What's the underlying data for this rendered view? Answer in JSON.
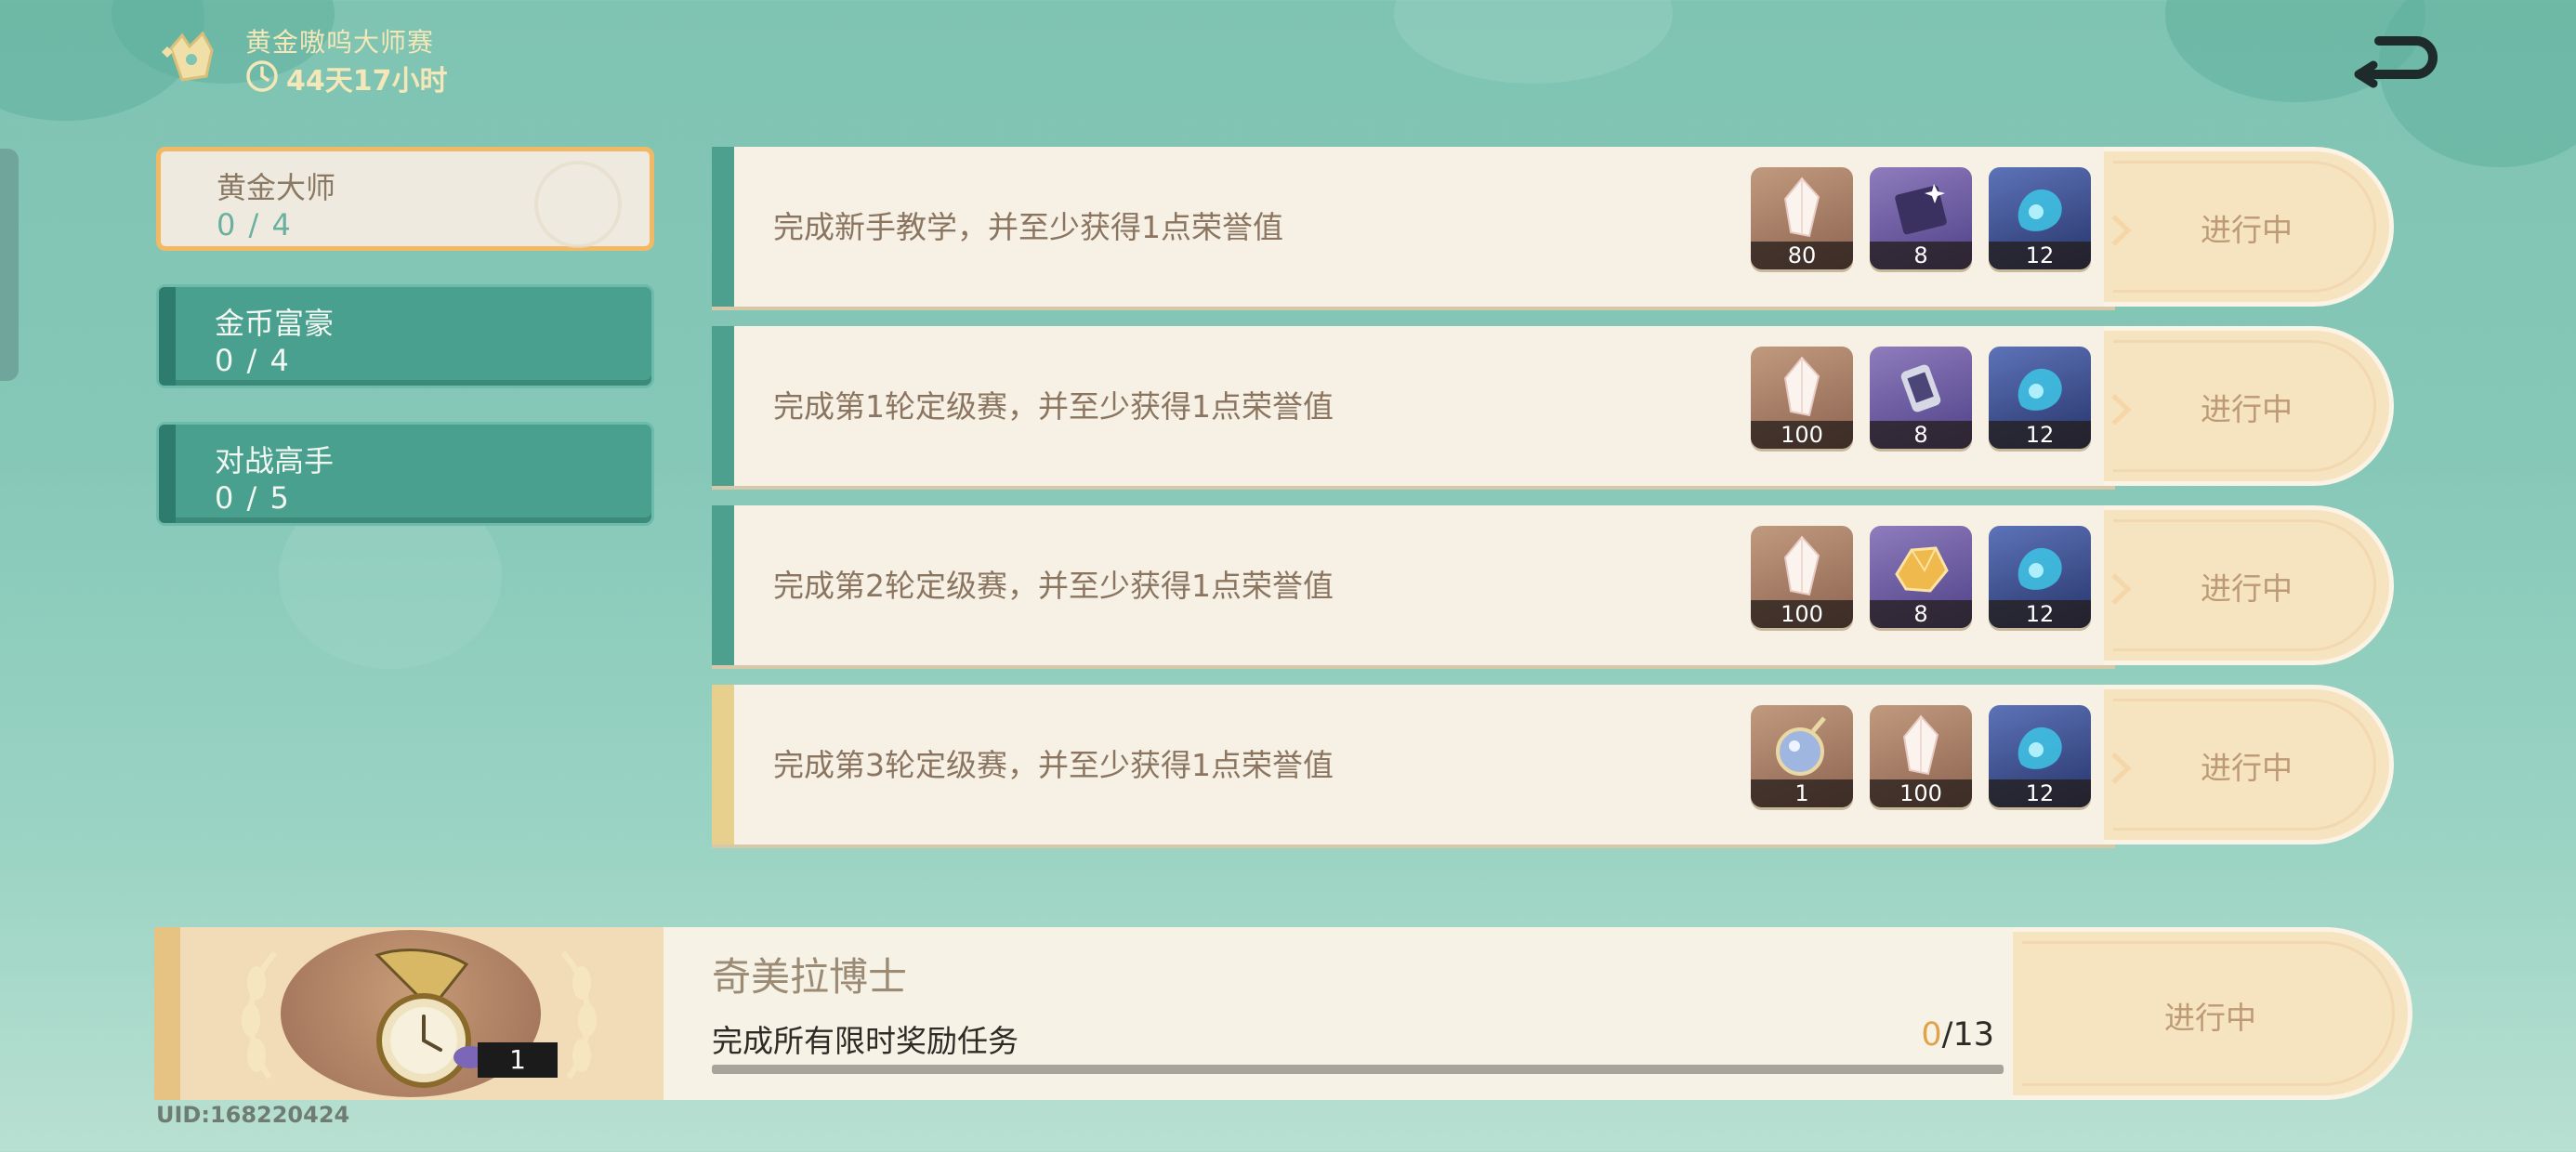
{
  "header": {
    "event_title": "黄金嗷呜大师赛",
    "time_left": "44天17小时"
  },
  "tabs": [
    {
      "name": "黄金大师",
      "count": "0 / 4",
      "active": true
    },
    {
      "name": "金币富豪",
      "count": "0 / 4",
      "active": false
    },
    {
      "name": "对战高手",
      "count": "0 / 5",
      "active": false
    }
  ],
  "quests": [
    {
      "text": "完成新手教学，并至少获得1点荣誉值",
      "status": "进行中",
      "rewards": [
        {
          "icon": "crystal-icon",
          "qty": "80"
        },
        {
          "icon": "book-icon",
          "qty": "8"
        },
        {
          "icon": "blue-spirit-icon",
          "qty": "12"
        }
      ]
    },
    {
      "text": "完成第1轮定级赛，并至少获得1点荣誉值",
      "status": "进行中",
      "rewards": [
        {
          "icon": "crystal-icon",
          "qty": "100"
        },
        {
          "icon": "lantern-icon",
          "qty": "8"
        },
        {
          "icon": "blue-spirit-icon",
          "qty": "12"
        }
      ]
    },
    {
      "text": "完成第2轮定级赛，并至少获得1点荣誉值",
      "status": "进行中",
      "rewards": [
        {
          "icon": "crystal-icon",
          "qty": "100"
        },
        {
          "icon": "gold-ore-icon",
          "qty": "8"
        },
        {
          "icon": "blue-spirit-icon",
          "qty": "12"
        }
      ]
    },
    {
      "text": "完成第3轮定级赛，并至少获得1点荣誉值",
      "status": "进行中",
      "rewards": [
        {
          "icon": "orb-icon",
          "qty": "1"
        },
        {
          "icon": "crystal-icon",
          "qty": "100"
        },
        {
          "icon": "blue-spirit-icon",
          "qty": "12"
        }
      ]
    }
  ],
  "grand_quest": {
    "title": "奇美拉博士",
    "description": "完成所有限时奖励任务",
    "progress_current": "0",
    "progress_total": "/13",
    "progress_fraction": 0,
    "reward_icon": "pocket-watch-icon",
    "reward_qty": "1",
    "status": "进行中"
  },
  "uid": "UID:168220424",
  "colors": {
    "teal_accent": "#4d9f8e",
    "gold_accent": "#f2b964",
    "status_text": "#bc9a76"
  }
}
